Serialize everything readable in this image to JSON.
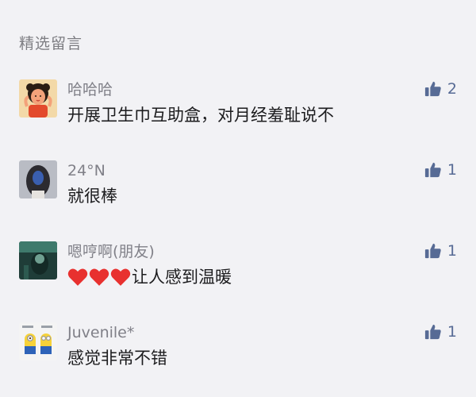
{
  "section": {
    "title": "精选留言"
  },
  "comments": [
    {
      "nickname": "哈哈哈",
      "content": "开展卫生巾互助盒，对月经羞耻说不",
      "likes": "2",
      "avatar": "cartoon-girl-avatar"
    },
    {
      "nickname": "24°N",
      "content": "就很棒",
      "likes": "1",
      "avatar": "portrait-photo-avatar"
    },
    {
      "nickname": "嗯哼啊(朋友)",
      "content_emoji": "❤❤❤",
      "content": "让人感到温暖",
      "likes": "1",
      "avatar": "dark-teal-photo-avatar"
    },
    {
      "nickname": "Juvenile*",
      "content": "感觉非常不错",
      "likes": "1",
      "avatar": "minions-avatar"
    }
  ],
  "colors": {
    "like_icon": "#576b95",
    "nickname": "#808088",
    "content": "#1c1c1e",
    "heart": "#e8312f"
  }
}
